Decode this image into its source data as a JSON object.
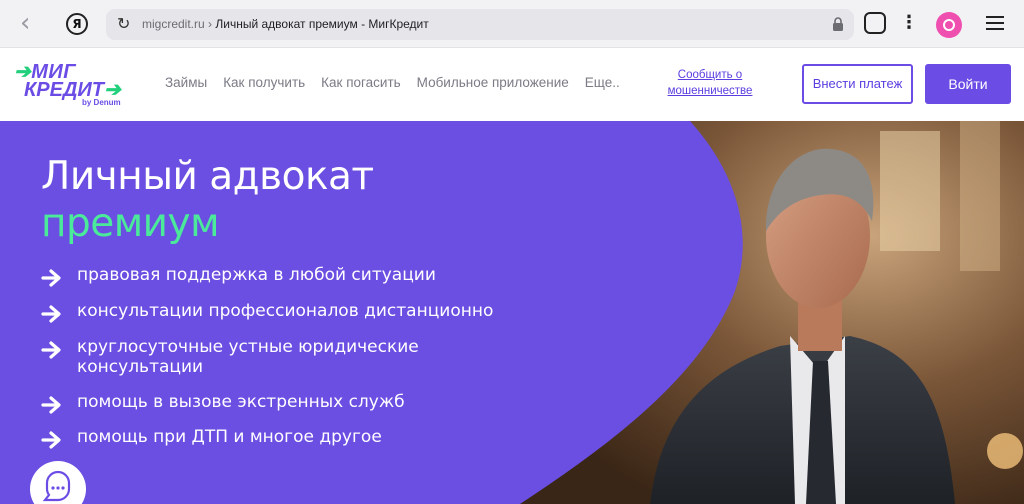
{
  "browser": {
    "domain": "migcredit.ru",
    "separator": " › ",
    "page_title": "Личный адвокат премиум - МигКредит",
    "yandex_glyph": "Я"
  },
  "header": {
    "logo": {
      "line1": "МИГ",
      "line2": "КРЕДИТ",
      "byline": "by Denum"
    },
    "nav": [
      "Займы",
      "Как получить",
      "Как погасить",
      "Мобильное приложение",
      "Еще.."
    ],
    "fraud_link": "Сообщить о мошенничестве",
    "pay_button": "Внести платеж",
    "login_button": "Войти"
  },
  "hero": {
    "title": "Личный адвокат",
    "subtitle": "премиум",
    "features": [
      "правовая поддержка в любой ситуации",
      "консультации профессионалов дистанционно",
      "круглосуточные устные юридические консультации",
      "помощь в вызове экстренных служб",
      "помощь при ДТП и многое другое"
    ]
  },
  "colors": {
    "brand_purple": "#6b4ee2",
    "accent_green": "#4be99a"
  }
}
